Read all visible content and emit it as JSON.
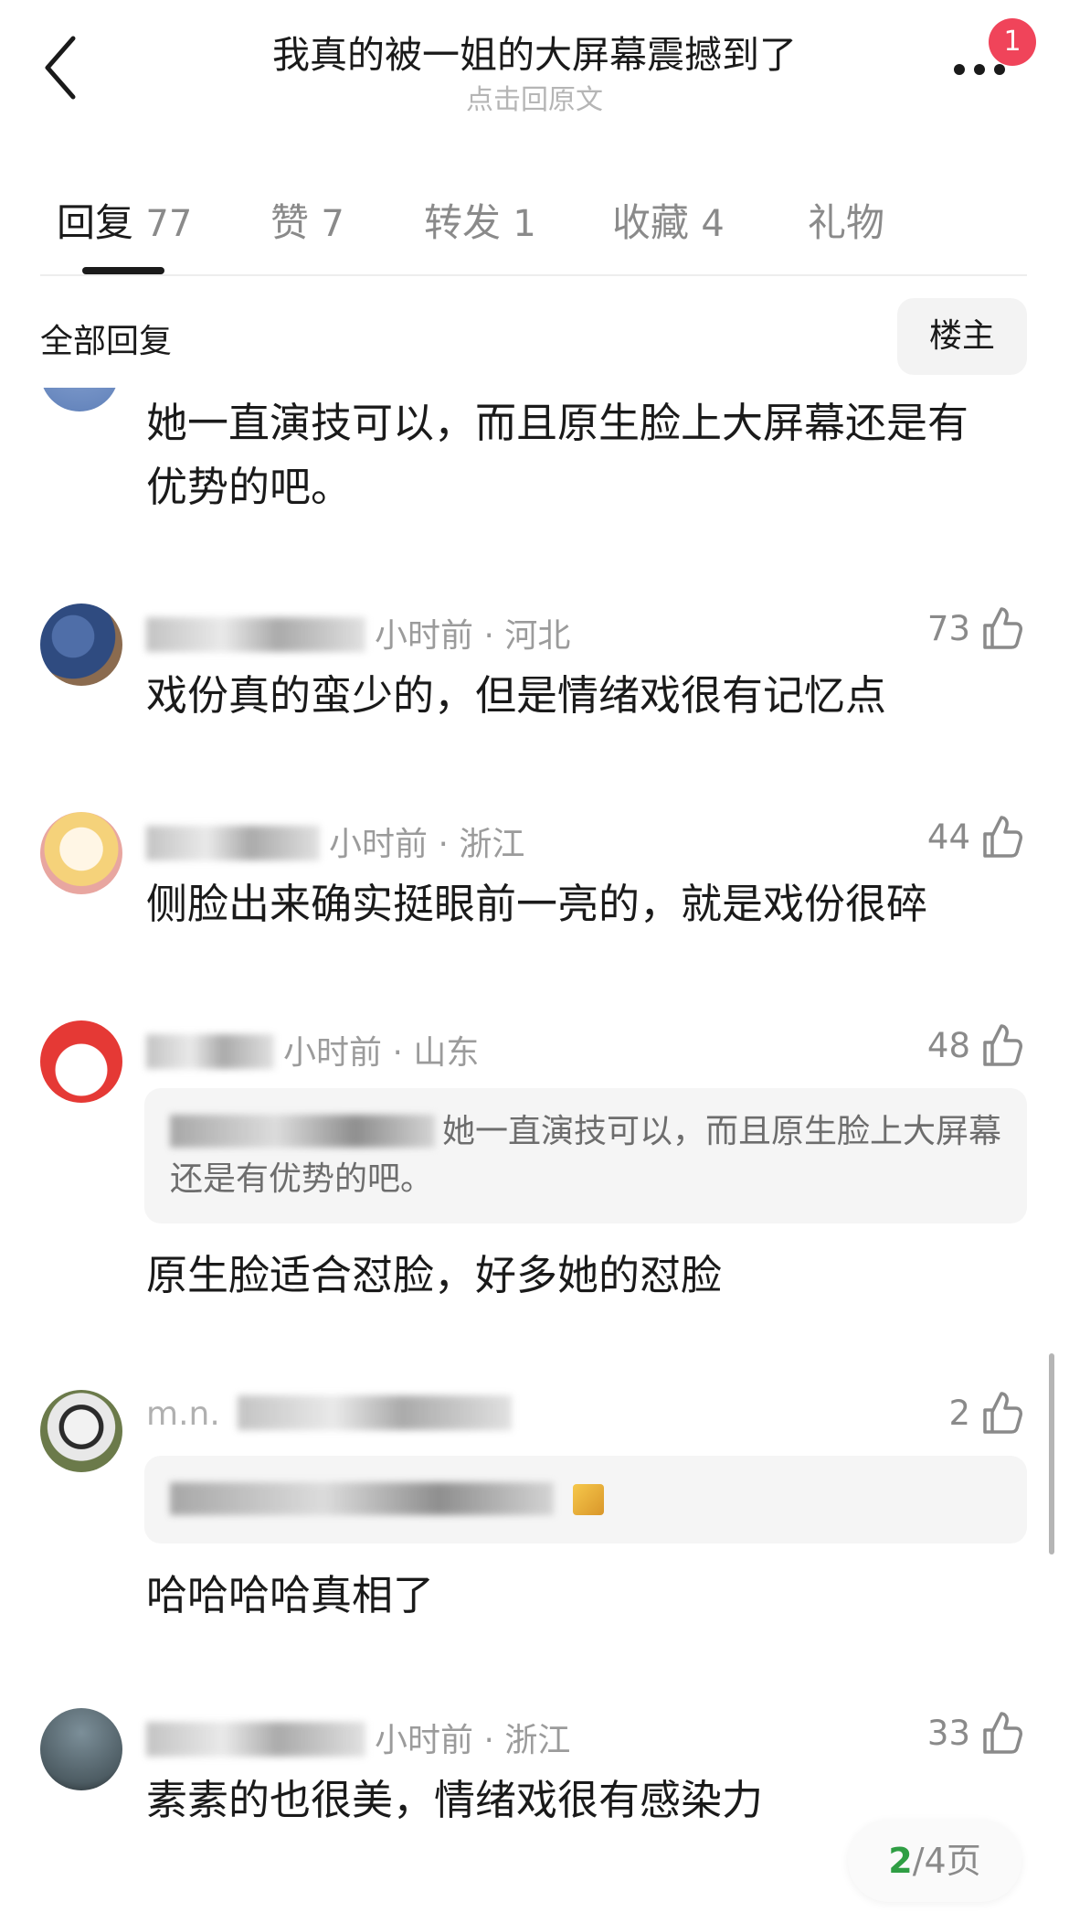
{
  "header": {
    "title": "我真的被一姐的大屏幕震撼到了",
    "subtitle": "点击回原文",
    "notification_count": "1"
  },
  "tabs": [
    {
      "label": "回复",
      "count": "77"
    },
    {
      "label": "赞",
      "count": "7"
    },
    {
      "label": "转发",
      "count": "1"
    },
    {
      "label": "收藏",
      "count": "4"
    },
    {
      "label": "礼物",
      "count": ""
    }
  ],
  "filter": {
    "label": "全部回复",
    "owner_button": "楼主"
  },
  "comments": [
    {
      "text": "她一直演技可以，而且原生脸上大屏幕还是有优势的吧。"
    },
    {
      "time_location": "小时前 · 河北",
      "likes": "73",
      "text": "戏份真的蛮少的，但是情绪戏很有记忆点"
    },
    {
      "time_location": "小时前 · 浙江",
      "likes": "44",
      "text": "侧脸出来确实挺眼前一亮的，就是戏份很碎"
    },
    {
      "time_location": "小时前 · 山东",
      "likes": "48",
      "quote": "她一直演技可以，而且原生脸上大屏幕还是有优势的吧。",
      "text": "原生脸适合怼脸，好多她的怼脸"
    },
    {
      "username": "m.n.",
      "likes": "2",
      "text": "哈哈哈哈真相了"
    },
    {
      "time_location": "小时前 · 浙江",
      "likes": "33",
      "text": "素素的也很美，情绪戏很有感染力"
    }
  ],
  "pager": {
    "current": "2",
    "total": "/4页"
  },
  "icons": {
    "back": "chevron-left-icon",
    "more": "ellipsis-icon",
    "like": "thumbs-up-icon"
  },
  "colors": {
    "badge": "#f0445a",
    "pager_current": "#2f9e44",
    "quote_bg": "#f5f5f5"
  }
}
